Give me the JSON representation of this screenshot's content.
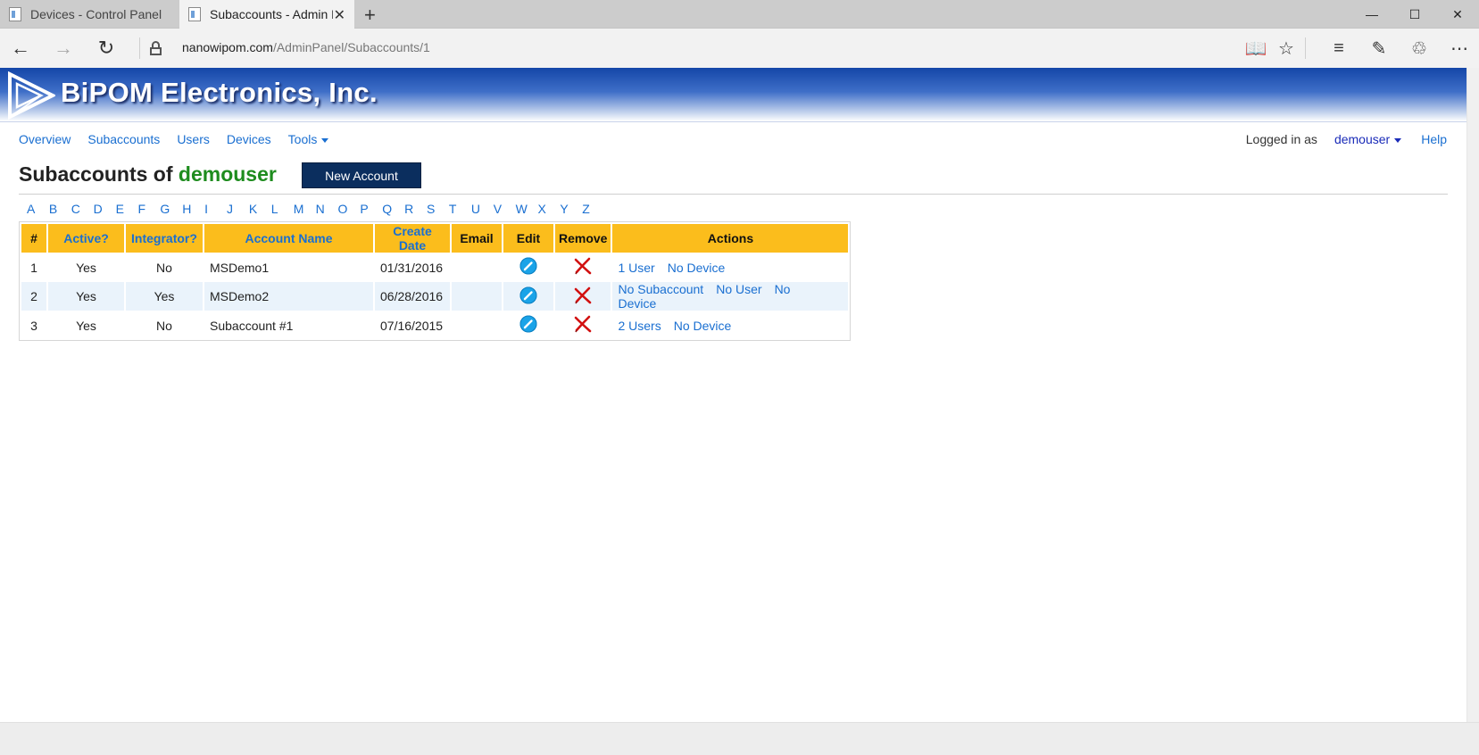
{
  "browser": {
    "tabs": [
      {
        "title": "Devices - Control Panel"
      },
      {
        "title": "Subaccounts - Admin Panel"
      }
    ],
    "url_host": "nanowipom.com",
    "url_path": "/AdminPanel/Subaccounts/1"
  },
  "site": {
    "brand": "BiPOM Electronics, Inc."
  },
  "menu": {
    "items": [
      "Overview",
      "Subaccounts",
      "Users",
      "Devices"
    ],
    "tools_label": "Tools"
  },
  "user_area": {
    "logged_in_label": "Logged in as",
    "username": "demouser",
    "help": "Help"
  },
  "page": {
    "title_prefix": "Subaccounts of",
    "owner": "demouser",
    "new_account_label": "New Account"
  },
  "letters": [
    "A",
    "B",
    "C",
    "D",
    "E",
    "F",
    "G",
    "H",
    "I",
    "J",
    "K",
    "L",
    "M",
    "N",
    "O",
    "P",
    "Q",
    "R",
    "S",
    "T",
    "U",
    "V",
    "W",
    "X",
    "Y",
    "Z"
  ],
  "table": {
    "headers": [
      "#",
      "Active?",
      "Integrator?",
      "Account Name",
      "Create Date",
      "Email",
      "Edit",
      "Remove",
      "Actions"
    ],
    "rows": [
      {
        "num": "1",
        "active": "Yes",
        "integrator": "No",
        "name": "MSDemo1",
        "date": "01/31/2016",
        "email": "",
        "actions": [
          "1 User",
          "No Device"
        ]
      },
      {
        "num": "2",
        "active": "Yes",
        "integrator": "Yes",
        "name": "MSDemo2",
        "date": "06/28/2016",
        "email": "",
        "actions": [
          "No Subaccount",
          "No User",
          "No Device"
        ]
      },
      {
        "num": "3",
        "active": "Yes",
        "integrator": "No",
        "name": "Subaccount #1",
        "date": "07/16/2015",
        "email": "",
        "actions": [
          "2 Users",
          "No Device"
        ]
      }
    ]
  },
  "colors": {
    "header_bg": "#fbbd1c",
    "link": "#1a6fd1",
    "owner": "#1e8c1e",
    "button_bg": "#0b2e5e"
  }
}
